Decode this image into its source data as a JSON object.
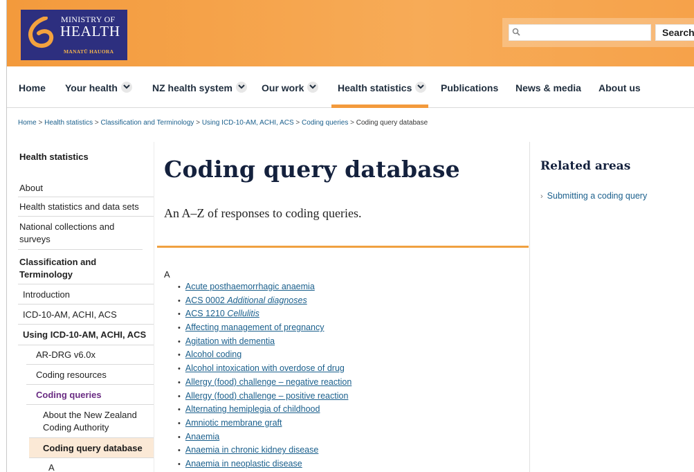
{
  "header": {
    "logo": {
      "line1": "MINISTRY OF",
      "line2": "HEALTH",
      "line3": "MANATŪ HAUORA"
    },
    "search": {
      "placeholder": "",
      "button_label": "Search",
      "icon": "search-icon"
    }
  },
  "nav": {
    "items": [
      {
        "label": "Home",
        "dropdown": false
      },
      {
        "label": "Your health",
        "dropdown": true
      },
      {
        "label": "NZ health system",
        "dropdown": true
      },
      {
        "label": "Our work",
        "dropdown": true
      },
      {
        "label": "Health statistics",
        "dropdown": true,
        "active": true
      },
      {
        "label": "Publications",
        "dropdown": false
      },
      {
        "label": "News & media",
        "dropdown": false
      },
      {
        "label": "About us",
        "dropdown": false
      }
    ],
    "active_color": "#f39a3c"
  },
  "breadcrumb": {
    "items": [
      "Home",
      "Health statistics",
      "Classification and Terminology",
      "Using ICD-10-AM, ACHI, ACS",
      "Coding queries"
    ],
    "current": "Coding query database",
    "separator": ">"
  },
  "sidebar": {
    "title": "Health statistics",
    "items": [
      {
        "label": "About"
      },
      {
        "label": "Health statistics and data sets"
      },
      {
        "label": "National collections and surveys"
      },
      {
        "label": "Classification and Terminology"
      },
      {
        "label": "Introduction"
      },
      {
        "label": "ICD-10-AM, ACHI, ACS"
      },
      {
        "label": "Using ICD-10-AM, ACHI, ACS"
      },
      {
        "label": "AR-DRG v6.0x"
      },
      {
        "label": "Coding resources"
      },
      {
        "label": "Coding queries"
      },
      {
        "label": "About the New Zealand Coding Authority"
      },
      {
        "label": "Coding query database"
      },
      {
        "label": "A"
      }
    ]
  },
  "main": {
    "title": "Coding query database",
    "subtitle": "An A–Z of responses to coding queries.",
    "letter": "A",
    "entries": [
      {
        "text": "Acute posthaemorrhagic anaemia"
      },
      {
        "text": "ACS 0002 ",
        "italic": "Additional diagnoses"
      },
      {
        "text": "ACS 1210 ",
        "italic": "Cellulitis"
      },
      {
        "text": "Affecting management of pregnancy"
      },
      {
        "text": "Agitation with dementia"
      },
      {
        "text": "Alcohol coding"
      },
      {
        "text": "Alcohol intoxication with overdose of drug"
      },
      {
        "text": "Allergy (food) challenge – negative reaction"
      },
      {
        "text": "Allergy (food) challenge – positive reaction"
      },
      {
        "text": "Alternating hemiplegia of childhood"
      },
      {
        "text": "Amniotic membrane graft"
      },
      {
        "text": "Anaemia"
      },
      {
        "text": "Anaemia in chronic kidney disease"
      },
      {
        "text": "Anaemia in neoplastic disease"
      }
    ]
  },
  "related": {
    "title": "Related areas",
    "links": [
      "Submitting a coding query"
    ]
  },
  "colors": {
    "brand_navy": "#2d2f7f",
    "header_orange": "#f6a44b",
    "link": "#1a5f8c",
    "heading": "#14213d",
    "sidebar_highlight": "#fbe9d6",
    "coding_queries_purple": "#6a2c83"
  }
}
